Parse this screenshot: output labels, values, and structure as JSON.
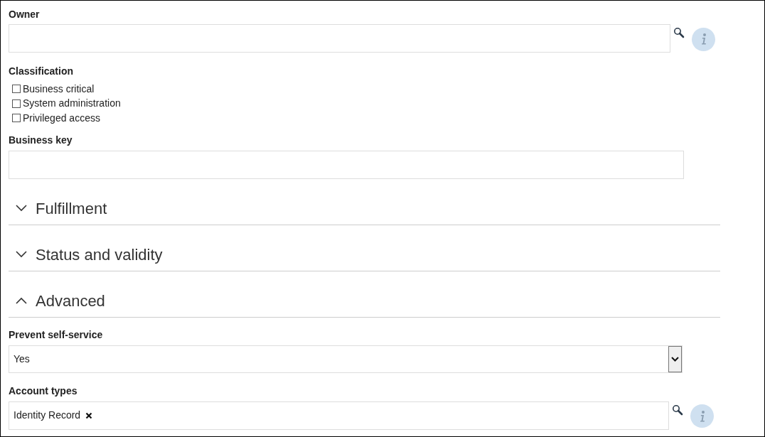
{
  "owner": {
    "label": "Owner"
  },
  "classification": {
    "label": "Classification",
    "options": [
      {
        "label": "Business critical",
        "checked": false
      },
      {
        "label": "System administration",
        "checked": false
      },
      {
        "label": "Privileged access",
        "checked": false
      }
    ]
  },
  "business_key": {
    "label": "Business key"
  },
  "sections": [
    {
      "title": "Fulfillment",
      "expanded": false
    },
    {
      "title": "Status and validity",
      "expanded": false
    },
    {
      "title": "Advanced",
      "expanded": true
    }
  ],
  "prevent_self_service": {
    "label": "Prevent self-service",
    "value": "Yes"
  },
  "account_types": {
    "label": "Account types",
    "tags": [
      {
        "label": "Identity Record"
      }
    ]
  }
}
